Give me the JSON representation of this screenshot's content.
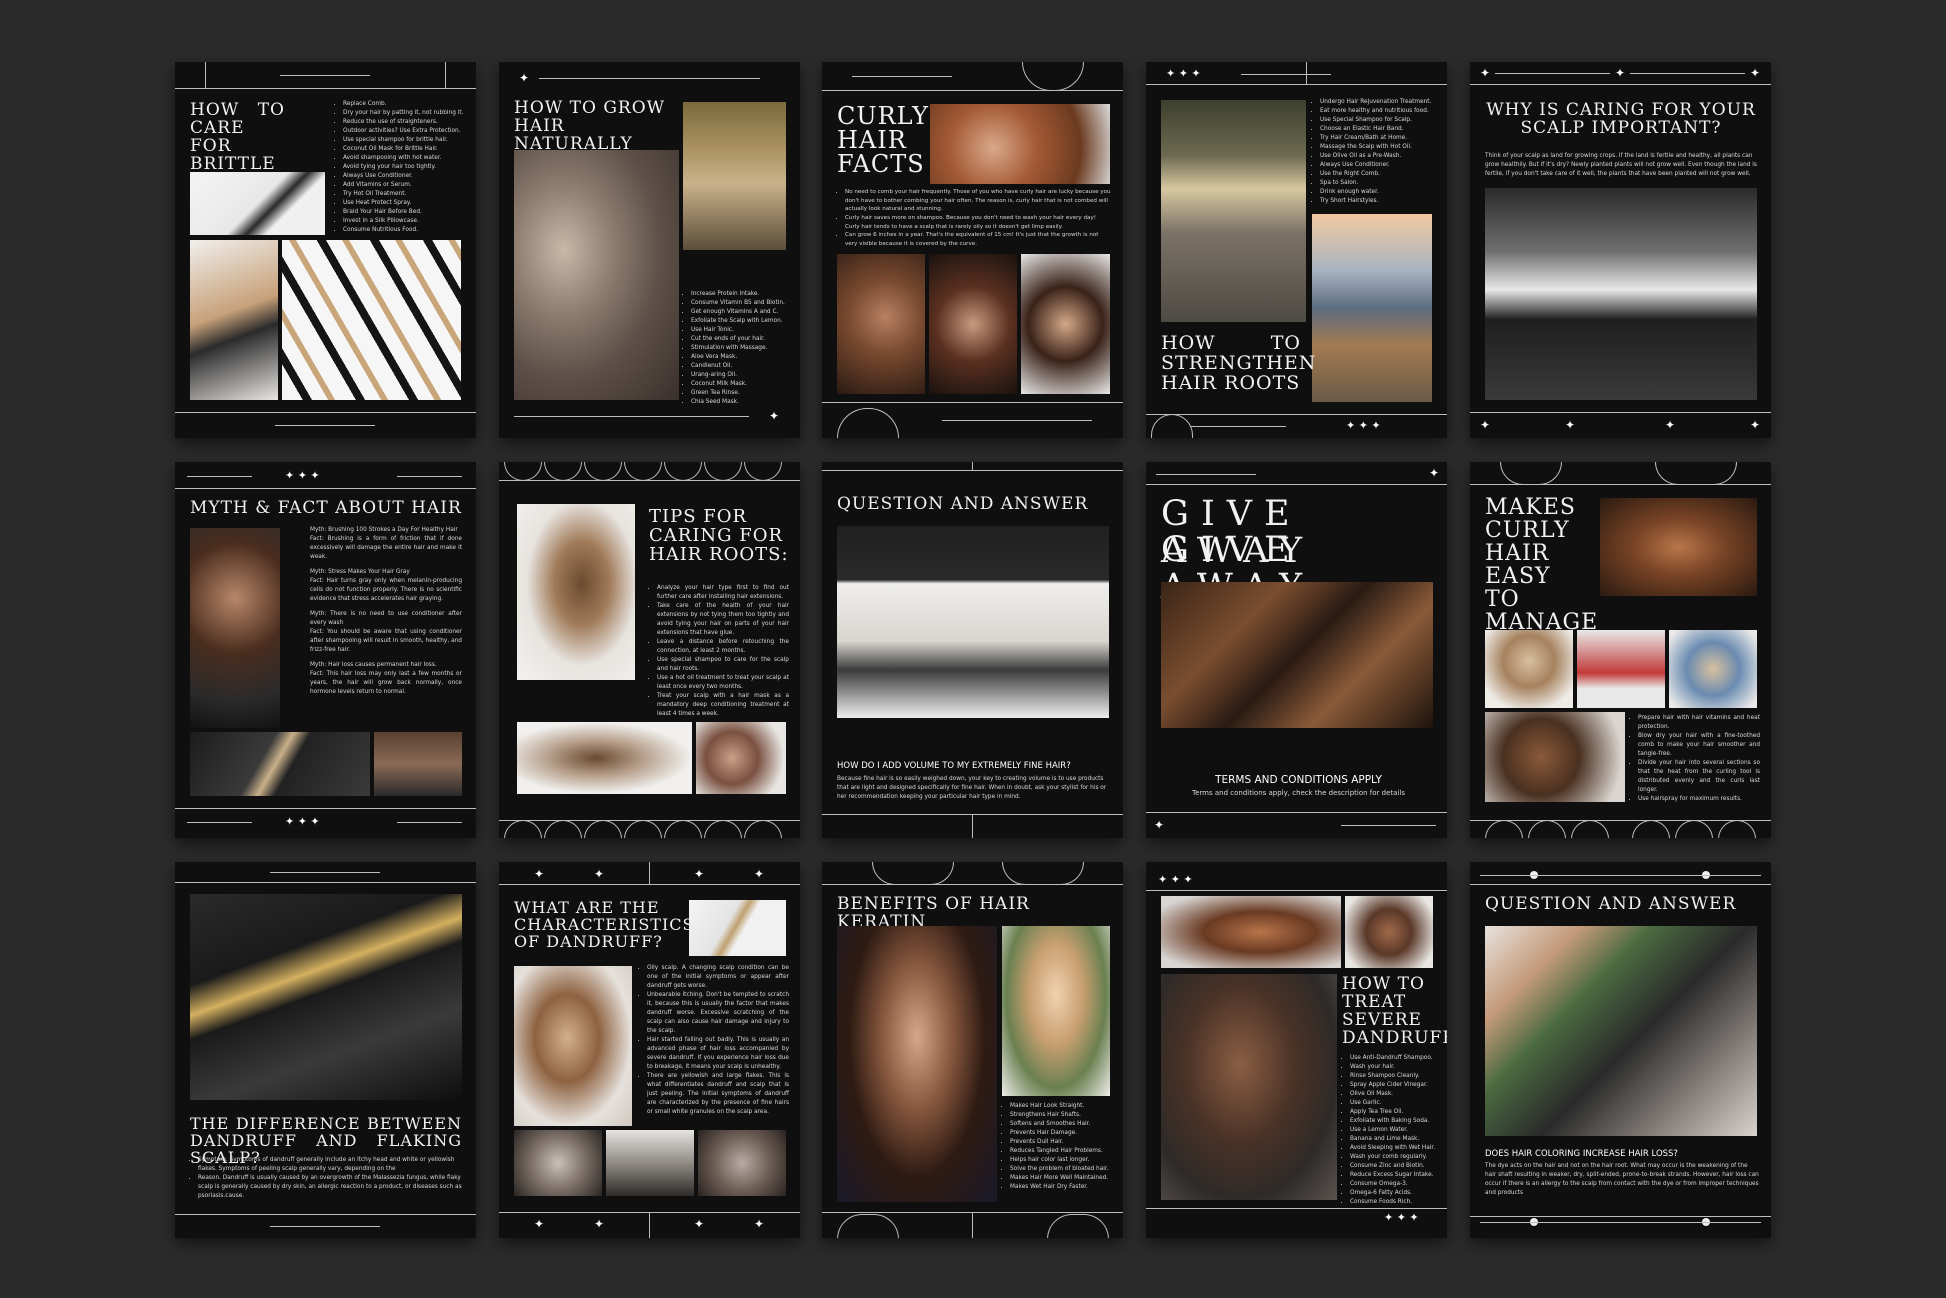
{
  "card1": {
    "title": "HOW TO CARE FOR BRITTLE HAIR",
    "items": [
      "Replace Comb.",
      "Dry your hair by patting it, not rubbing it.",
      "Reduce the use of straighteners.",
      "Outdoor activities? Use Extra Protection.",
      "Use special shampoo for brittle hair.",
      "Coconut Oil Mask for Brittle Hair.",
      "Avoid shampooing with hot water.",
      "Avoid tying your hair too tightly.",
      "Always Use Conditioner.",
      "Add Vitamins or Serum.",
      "Try Hot Oil Treatment.",
      "Use Heat Protect Spray.",
      "Braid Your Hair Before Bed.",
      "Invest in a Silk Pillowcase.",
      "Consume Nutritious Food."
    ]
  },
  "card2": {
    "title": "HOW TO GROW HAIR NATURALLY",
    "items": [
      "Increase Protein Intake.",
      "Consume Vitamin B5 and Biotin.",
      "Get enough Vitamins A and C.",
      "Exfoliate the Scalp with Lemon.",
      "Use Hair Tonic.",
      "Cut the ends of your hair.",
      "Stimulation with Massage.",
      "Aloe Vera Mask.",
      "Candlenut Oil.",
      "Urang-aring Oil.",
      "Coconut Milk Mask.",
      "Green Tea Rinse.",
      "Chia Seed Mask."
    ]
  },
  "card3": {
    "title": "CURLY HAIR FACTS",
    "items": [
      "No need to comb your hair frequently. Those of you who have curly hair are lucky because you don't have to bother combing your hair often. The reason is, curly hair that is not combed will actually look natural and stunning.",
      "Curly hair saves more on shampoo. Because you don't need to wash your hair every day! Curly hair tends to have a scalp that is rarely oily so it doesn't get limp easily.",
      "Can grow 6 inches in a year. That's the equivalent of 15 cm! It's just that the growth is not very visible because it is covered by the curve."
    ]
  },
  "card4": {
    "title": "HOW TO STRENGTHEN HAIR ROOTS",
    "items": [
      "Undergo Hair Rejuvenation Treatment.",
      "Eat more healthy and nutritious food.",
      "Use Special Shampoo for Scalp.",
      "Choose an Elastic Hair Band.",
      "Try Hair Cream/Bath at Home.",
      "Massage the Scalp with Hot Oil.",
      "Use Olive Oil as a Pre-Wash.",
      "Always Use Conditioner.",
      "Use the Right Comb.",
      "Spa to Salon.",
      "Drink enough water.",
      "Try Short Hairstyles."
    ]
  },
  "card5": {
    "title": "WHY IS CARING FOR YOUR SCALP IMPORTANT?",
    "body": "Think of your scalp as land for growing crops. If the land is fertile and healthy, all plants can grow healthily. But if it's dry? Newly planted plants will not grow well. Even though the land is fertile, if you don't take care of it well, the plants that have been planted will not grow well."
  },
  "card6": {
    "title": "MYTH & FACT ABOUT HAIR",
    "paras": [
      "Myth: Brushing 100 Strokes a Day For Healthy Hair",
      "Fact: Brushing is a form of friction that if done excessively will damage the entire hair and make it weak.",
      "Myth: Stress Makes Your Hair Gray",
      "Fact: Hair turns gray only when melanin-producing cells do not function properly. There is no scientific evidence that stress accelerates hair graying.",
      "Myth: There is no need to use conditioner after every wash",
      "Fact: You should be aware that using conditioner after shampooing will result in smooth, healthy, and frizz-free hair.",
      "Myth: Hair loss causes permanent hair loss.",
      "Fact: This hair loss may only last a few months or years, the hair will grow back normally, once hormone levels return to normal."
    ]
  },
  "card7": {
    "title": "TIPS FOR CARING FOR HAIR ROOTS:",
    "items": [
      "Analyze your hair type first to find out further care after installing hair extensions.",
      "Take care of the health of your hair extensions by not tying them too tightly and avoid tying your hair on parts of your hair extensions that have glue.",
      "Leave a distance before retouching the connection, at least 2 months.",
      "Use special shampoo to care for the scalp and hair roots.",
      "Use a hot oil treatment to treat your scalp at least once every two months.",
      "Treat your scalp with a hair mask as a mandatory deep conditioning treatment at least 4 times a week."
    ]
  },
  "card8": {
    "title": "QUESTION AND ANSWER",
    "question": "HOW DO I ADD VOLUME TO MY EXTREMELY FINE HAIR?",
    "answer": "Because fine hair is so easily weighed down, your key to creating volume is to use products that are light and designed specifically for fine hair. When in doubt, ask your stylist for his or her recommendation keeping your particular hair type in mind."
  },
  "card9": {
    "title1": "GIVE AWAY",
    "title2": "GIVE AWAY",
    "terms": "TERMS AND CONDITIONS APPLY",
    "sub": "Terms and conditions apply, check the description for details"
  },
  "card10": {
    "title": "MAKES CURLY HAIR EASY TO MANAGE",
    "items": [
      "Prepare hair with hair vitamins and heat protection.",
      "Blow dry your hair with a fine-toothed comb to make your hair smoother and tangle-free.",
      "Divide your hair into several sections so that the heat from the curling tool is distributed evenly and the curls last longer.",
      "Use hairspray for maximum results."
    ]
  },
  "card11": {
    "title": "THE DIFFERENCE BETWEEN DANDRUFF AND FLAKING SCALP?",
    "items": [
      "Symptom. Symptoms of dandruff generally include an itchy head and white or yellowish flakes. Symptoms of peeling scalp generally vary, depending on the",
      "Reason. Dandruff is usually caused by an overgrowth of the Malassezia fungus, while flaky scalp is generally caused by dry skin, an allergic reaction to a product, or diseases such as psoriasis.cause."
    ]
  },
  "card12": {
    "title": "WHAT ARE THE CHARACTERISTICS OF DANDRUFF?",
    "items": [
      "Oily scalp. A changing scalp condition can be one of the initial symptoms or appear after dandruff gets worse.",
      "Unbearable itching. Don't be tempted to scratch it, because this is usually the factor that makes dandruff worse. Excessive scratching of the scalp can also cause hair damage and injury to the scalp.",
      "Hair started falling out badly. This is usually an advanced phase of hair loss accompanied by severe dandruff. If you experience hair loss due to breakage, it means your scalp is unhealthy.",
      "There are yellowish and large flakes. This is what differentiates dandruff and scalp that is just peeling. The initial symptoms of dandruff are characterized by the presence of fine hairs or small white granules on the scalp area."
    ]
  },
  "card13": {
    "title": "BENEFITS OF HAIR KERATIN",
    "items": [
      "Makes Hair Look Straight.",
      "Strengthens Hair Shafts.",
      "Softens and Smoothes Hair.",
      "Prevents Hair Damage.",
      "Prevents Dull Hair.",
      "Reduces Tangled Hair Problems.",
      "Helps hair color last longer.",
      "Solve the problem of bloated hair.",
      "Makes Hair More Well Maintained.",
      "Makes Wet Hair Dry Faster."
    ]
  },
  "card14": {
    "title": "HOW TO TREAT SEVERE DANDRUFF",
    "items": [
      "Use Anti-Dandruff Shampoo.",
      "Wash your hair.",
      "Rinse Shampoo Cleanly.",
      "Spray Apple Cider Vinegar.",
      "Olive Oil Mask.",
      "Use Garlic.",
      "Apply Tea Tree Oil.",
      "Exfoliate with Baking Soda.",
      "Use a Lemon Water.",
      "Banana and Lime Mask.",
      "Avoid Sleeping with Wet Hair.",
      "Wash your comb regularly.",
      "Consume Zinc and Biotin.",
      "Reduce Excess Sugar Intake.",
      "Consume Omega-3.",
      "Omega-6 Fatty Acids.",
      "Consume Foods Rich."
    ]
  },
  "card15": {
    "title": "QUESTION AND ANSWER",
    "question": "DOES HAIR COLORING INCREASE HAIR LOSS?",
    "answer": "The dye acts on the hair and not on the hair root. What may occur is the weakening of the hair shaft resulting in weaker, dry, split-ended, prone-to-break strands. However, hair loss can occur if there is an allergy to the scalp from contact with the dye or from improper techniques and products"
  },
  "colors": {
    "background": "#2b2b2b",
    "card": "#0f0f0f",
    "accent": "#ffffff"
  }
}
